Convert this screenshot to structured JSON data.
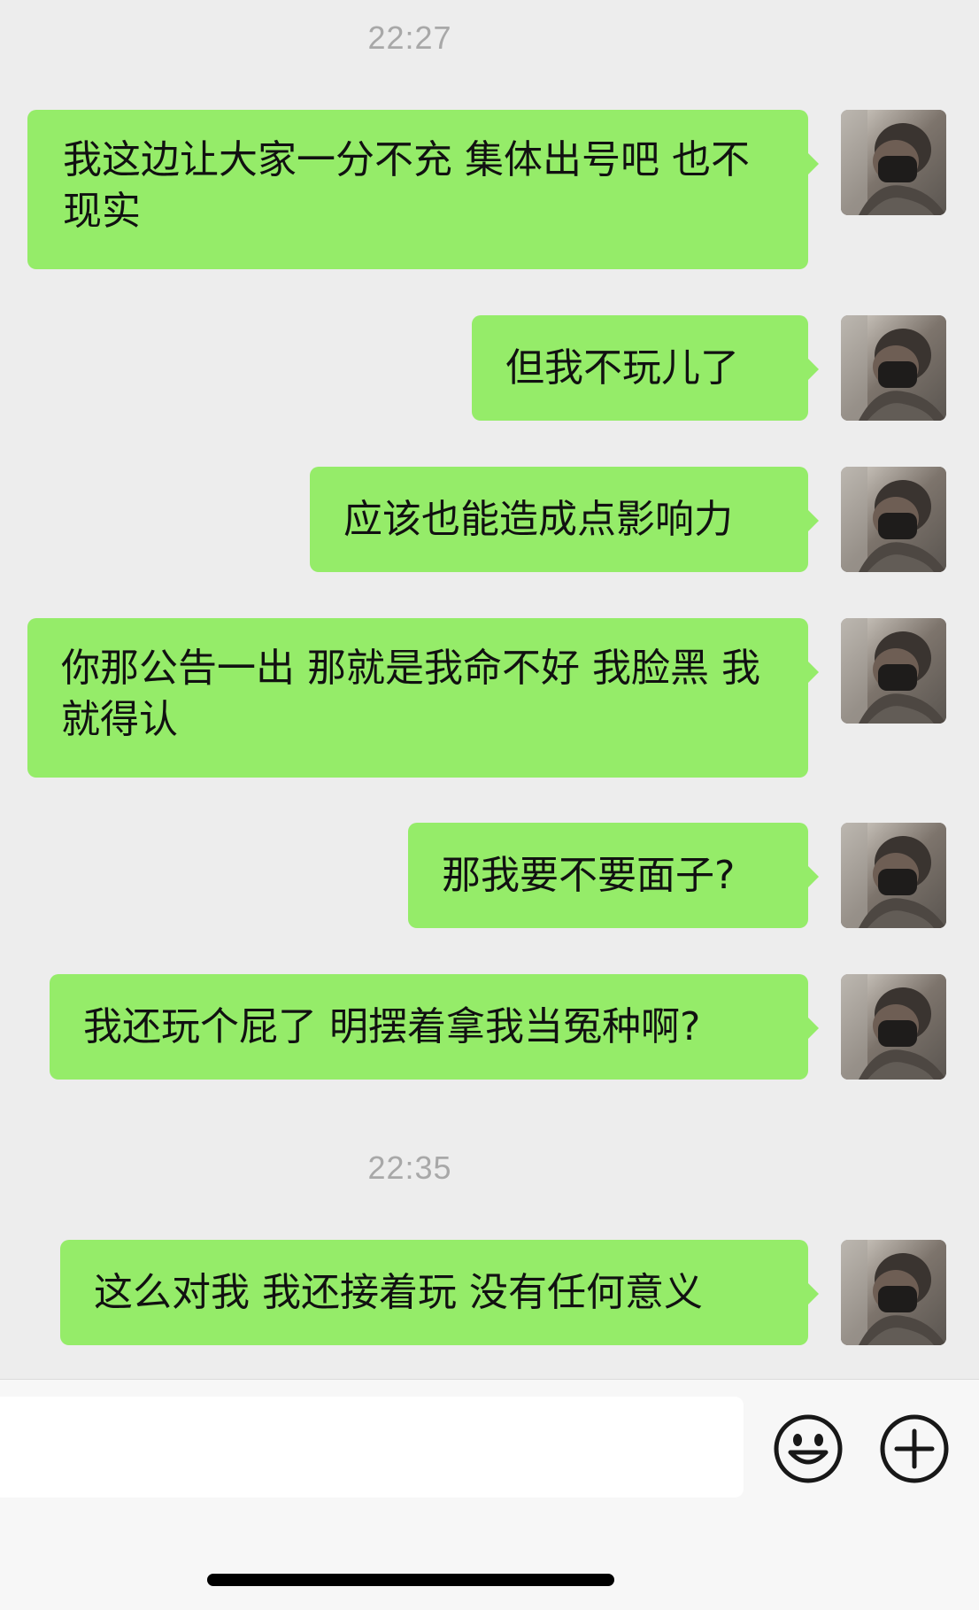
{
  "timestamps": [
    "22:27",
    "22:35"
  ],
  "messages": [
    {
      "text": "我这边让大家一分不充 集体出号吧 也不现实"
    },
    {
      "text": "但我不玩儿了"
    },
    {
      "text": "应该也能造成点影响力"
    },
    {
      "text": "你那公告一出 那就是我命不好 我脸黑 我就得认"
    },
    {
      "text": "那我要不要面子?"
    },
    {
      "text": "我还玩个屁了 明摆着拿我当冤种啊?"
    },
    {
      "text": "这么对我 我还接着玩 没有任何意义"
    }
  ],
  "colors": {
    "background": "#ededed",
    "bubble": "#95ec69",
    "timestamp": "#a8a8a8",
    "input_bar": "#f7f7f7"
  },
  "input": {
    "value": "",
    "placeholder": ""
  },
  "icons": {
    "emoji": "emoji-icon",
    "add": "plus-icon"
  }
}
